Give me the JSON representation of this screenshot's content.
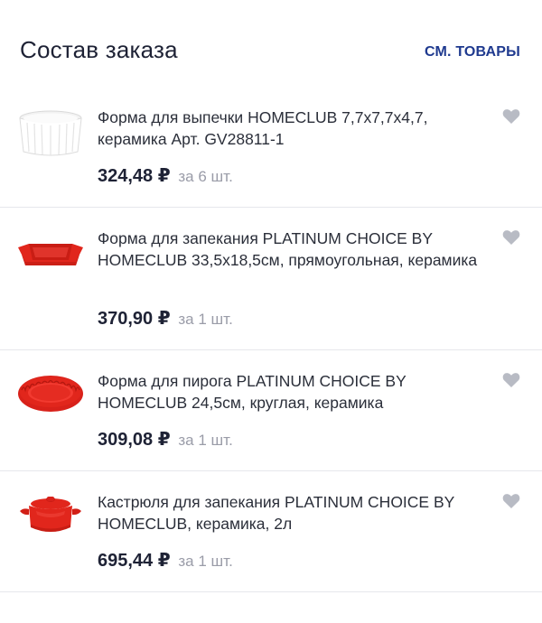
{
  "header": {
    "title": "Состав заказа",
    "see_products": "СМ. ТОВАРЫ"
  },
  "colors": {
    "accent": "#1f3a8f",
    "text": "#1e2235",
    "muted": "#9a9ca8",
    "divider": "#e6e7ec",
    "product_red": "#e1261c"
  },
  "items": [
    {
      "name": "Форма для выпечки HOMECLUB 7,7х7,7х4,7, керамика Арт. GV28811-1",
      "price": "324,48 ₽",
      "qty": "за 6 шт.",
      "image_icon": "white-ramekin-icon"
    },
    {
      "name": "Форма для запекания PLATINUM CHOICE BY HOMECLUB 33,5х18,5см, прямоугольная, керамика",
      "price": "370,90 ₽",
      "qty": "за 1 шт.",
      "image_icon": "red-baking-dish-icon"
    },
    {
      "name": "Форма для пирога PLATINUM CHOICE BY HOMECLUB 24,5см, круглая, керамика",
      "price": "309,08 ₽",
      "qty": "за 1 шт.",
      "image_icon": "red-pie-dish-icon"
    },
    {
      "name": "Кастрюля для запекания PLATINUM CHOICE BY HOMECLUB, керамика, 2л",
      "price": "695,44 ₽",
      "qty": "за 1 шт.",
      "image_icon": "red-casserole-icon"
    }
  ]
}
